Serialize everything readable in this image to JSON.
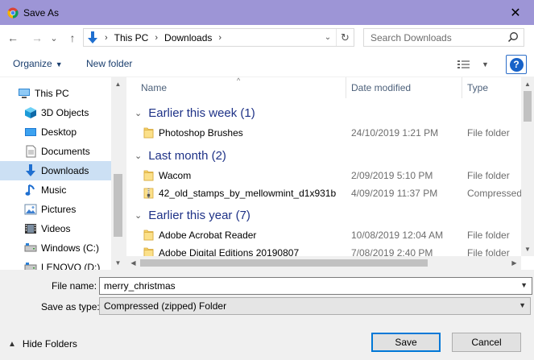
{
  "window": {
    "title": "Save As",
    "close_glyph": "✕",
    "app_icon": "chrome-icon"
  },
  "nav": {
    "back_glyph": "←",
    "forward_glyph": "→",
    "recent_glyph": "⌄",
    "up_glyph": "↑",
    "breadcrumb": [
      "This PC",
      "Downloads"
    ],
    "crumb_sep": "›",
    "dropdown_glyph": "⌄",
    "refresh_glyph": "↻",
    "search_placeholder": "Search Downloads"
  },
  "toolbar": {
    "organize_label": "Organize",
    "caret": "▼",
    "new_folder_label": "New folder",
    "help_label": "?"
  },
  "sidebar": {
    "items": [
      {
        "label": "This PC",
        "icon": "computer-icon",
        "selected": false
      },
      {
        "label": "3D Objects",
        "icon": "cube-icon",
        "selected": false
      },
      {
        "label": "Desktop",
        "icon": "desktop-icon",
        "selected": false
      },
      {
        "label": "Documents",
        "icon": "document-icon",
        "selected": false
      },
      {
        "label": "Downloads",
        "icon": "download-icon",
        "selected": true
      },
      {
        "label": "Music",
        "icon": "music-icon",
        "selected": false
      },
      {
        "label": "Pictures",
        "icon": "picture-icon",
        "selected": false
      },
      {
        "label": "Videos",
        "icon": "video-icon",
        "selected": false
      },
      {
        "label": "Windows (C:)",
        "icon": "drive-icon",
        "selected": false
      },
      {
        "label": "LENOVO (D:)",
        "icon": "drive-icon",
        "selected": false
      }
    ]
  },
  "columns": {
    "name": "Name",
    "date": "Date modified",
    "type": "Type",
    "sort_glyph": "^"
  },
  "groups": [
    {
      "title": "Earlier this week (1)",
      "files": [
        {
          "name": "Photoshop Brushes",
          "date": "24/10/2019 1:21 PM",
          "type": "File folder",
          "icon": "folder-icon"
        }
      ]
    },
    {
      "title": "Last month (2)",
      "files": [
        {
          "name": "Wacom",
          "date": "2/09/2019 5:10 PM",
          "type": "File folder",
          "icon": "folder-icon"
        },
        {
          "name": "42_old_stamps_by_mellowmint_d1x931b",
          "date": "4/09/2019 11:37 PM",
          "type": "Compressed",
          "icon": "zip-folder-icon"
        }
      ]
    },
    {
      "title": "Earlier this year (7)",
      "files": [
        {
          "name": "Adobe Acrobat Reader",
          "date": "10/08/2019 12:04 AM",
          "type": "File folder",
          "icon": "folder-icon"
        },
        {
          "name": "Adobe Digital Editions 20190807",
          "date": "7/08/2019 2:40 PM",
          "type": "File folder",
          "icon": "folder-icon"
        }
      ]
    }
  ],
  "form": {
    "file_name_label": "File name:",
    "file_name_value": "merry_christmas",
    "save_type_label": "Save as type:",
    "save_type_value": "Compressed (zipped) Folder"
  },
  "footer": {
    "hide_folders_label": "Hide Folders",
    "save_label": "Save",
    "cancel_label": "Cancel"
  },
  "colors": {
    "titlebar": "#9d95d6",
    "group_title": "#1e3287",
    "selected_item": "#cce0f4",
    "primary_button_border": "#0078d7"
  }
}
